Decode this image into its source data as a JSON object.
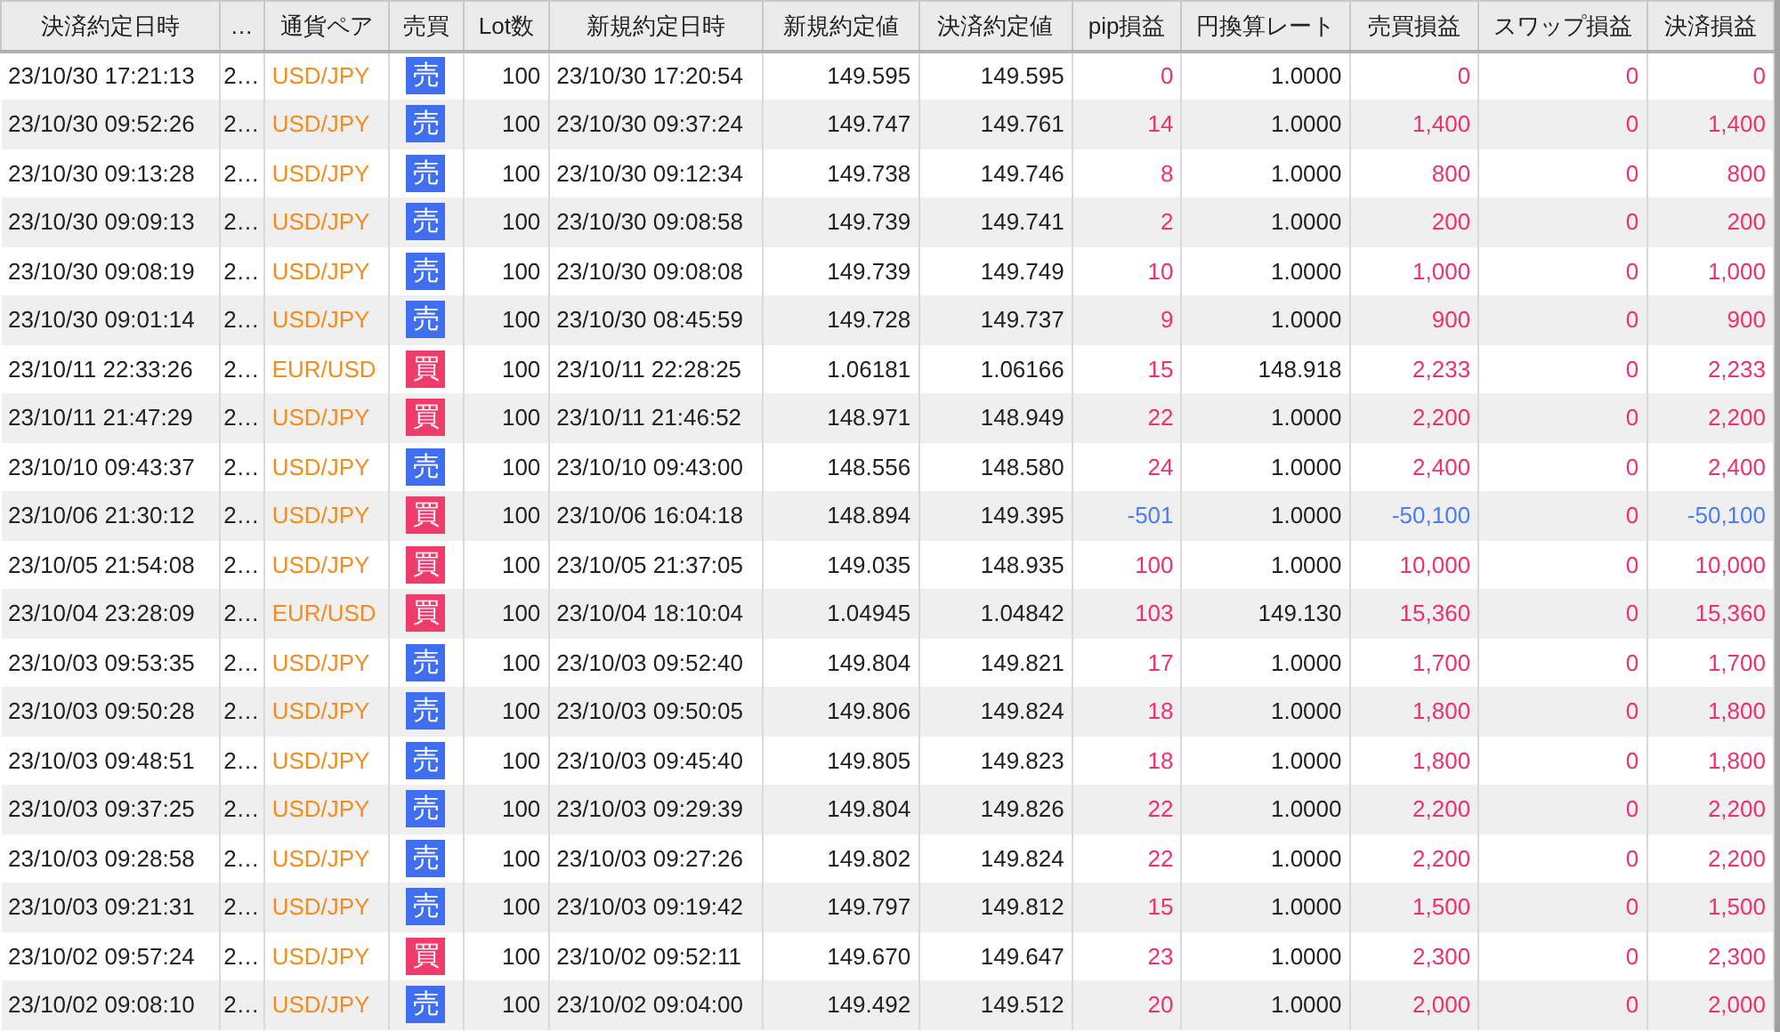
{
  "table": {
    "columns": [
      "決済約定日時",
      "…",
      "通貨ペア",
      "売買",
      "Lot数",
      "新規約定日時",
      "新規約定値",
      "決済約定値",
      "pip損益",
      "円換算レート",
      "売買損益",
      "スワップ損益",
      "決済損益"
    ],
    "rows": [
      {
        "close_time": "23/10/30 17:21:13",
        "column_2": "2…",
        "pair": "USD/JPY",
        "side": {
          "text": "売",
          "kind": "sell"
        },
        "lots": "100",
        "open_time": "23/10/30 17:20:54",
        "open_price": "149.595",
        "close_price": "149.595",
        "pips": "0",
        "rate": "1.0000",
        "trade_pl": "0",
        "swap_pl": "0",
        "settle_pl": "0",
        "loss": false
      },
      {
        "close_time": "23/10/30 09:52:26",
        "column_2": "2…",
        "pair": "USD/JPY",
        "side": {
          "text": "売",
          "kind": "sell"
        },
        "lots": "100",
        "open_time": "23/10/30 09:37:24",
        "open_price": "149.747",
        "close_price": "149.761",
        "pips": "14",
        "rate": "1.0000",
        "trade_pl": "1,400",
        "swap_pl": "0",
        "settle_pl": "1,400",
        "loss": false
      },
      {
        "close_time": "23/10/30 09:13:28",
        "column_2": "2…",
        "pair": "USD/JPY",
        "side": {
          "text": "売",
          "kind": "sell"
        },
        "lots": "100",
        "open_time": "23/10/30 09:12:34",
        "open_price": "149.738",
        "close_price": "149.746",
        "pips": "8",
        "rate": "1.0000",
        "trade_pl": "800",
        "swap_pl": "0",
        "settle_pl": "800",
        "loss": false
      },
      {
        "close_time": "23/10/30 09:09:13",
        "column_2": "2…",
        "pair": "USD/JPY",
        "side": {
          "text": "売",
          "kind": "sell"
        },
        "lots": "100",
        "open_time": "23/10/30 09:08:58",
        "open_price": "149.739",
        "close_price": "149.741",
        "pips": "2",
        "rate": "1.0000",
        "trade_pl": "200",
        "swap_pl": "0",
        "settle_pl": "200",
        "loss": false
      },
      {
        "close_time": "23/10/30 09:08:19",
        "column_2": "2…",
        "pair": "USD/JPY",
        "side": {
          "text": "売",
          "kind": "sell"
        },
        "lots": "100",
        "open_time": "23/10/30 09:08:08",
        "open_price": "149.739",
        "close_price": "149.749",
        "pips": "10",
        "rate": "1.0000",
        "trade_pl": "1,000",
        "swap_pl": "0",
        "settle_pl": "1,000",
        "loss": false
      },
      {
        "close_time": "23/10/30 09:01:14",
        "column_2": "2…",
        "pair": "USD/JPY",
        "side": {
          "text": "売",
          "kind": "sell"
        },
        "lots": "100",
        "open_time": "23/10/30 08:45:59",
        "open_price": "149.728",
        "close_price": "149.737",
        "pips": "9",
        "rate": "1.0000",
        "trade_pl": "900",
        "swap_pl": "0",
        "settle_pl": "900",
        "loss": false
      },
      {
        "close_time": "23/10/11 22:33:26",
        "column_2": "2…",
        "pair": "EUR/USD",
        "side": {
          "text": "買",
          "kind": "buy"
        },
        "lots": "100",
        "open_time": "23/10/11 22:28:25",
        "open_price": "1.06181",
        "close_price": "1.06166",
        "pips": "15",
        "rate": "148.918",
        "trade_pl": "2,233",
        "swap_pl": "0",
        "settle_pl": "2,233",
        "loss": false
      },
      {
        "close_time": "23/10/11 21:47:29",
        "column_2": "2…",
        "pair": "USD/JPY",
        "side": {
          "text": "買",
          "kind": "buy"
        },
        "lots": "100",
        "open_time": "23/10/11 21:46:52",
        "open_price": "148.971",
        "close_price": "148.949",
        "pips": "22",
        "rate": "1.0000",
        "trade_pl": "2,200",
        "swap_pl": "0",
        "settle_pl": "2,200",
        "loss": false
      },
      {
        "close_time": "23/10/10 09:43:37",
        "column_2": "2…",
        "pair": "USD/JPY",
        "side": {
          "text": "売",
          "kind": "sell"
        },
        "lots": "100",
        "open_time": "23/10/10 09:43:00",
        "open_price": "148.556",
        "close_price": "148.580",
        "pips": "24",
        "rate": "1.0000",
        "trade_pl": "2,400",
        "swap_pl": "0",
        "settle_pl": "2,400",
        "loss": false
      },
      {
        "close_time": "23/10/06 21:30:12",
        "column_2": "2…",
        "pair": "USD/JPY",
        "side": {
          "text": "買",
          "kind": "buy"
        },
        "lots": "100",
        "open_time": "23/10/06 16:04:18",
        "open_price": "148.894",
        "close_price": "149.395",
        "pips": "-501",
        "rate": "1.0000",
        "trade_pl": "-50,100",
        "swap_pl": "0",
        "settle_pl": "-50,100",
        "loss": true
      },
      {
        "close_time": "23/10/05 21:54:08",
        "column_2": "2…",
        "pair": "USD/JPY",
        "side": {
          "text": "買",
          "kind": "buy"
        },
        "lots": "100",
        "open_time": "23/10/05 21:37:05",
        "open_price": "149.035",
        "close_price": "148.935",
        "pips": "100",
        "rate": "1.0000",
        "trade_pl": "10,000",
        "swap_pl": "0",
        "settle_pl": "10,000",
        "loss": false
      },
      {
        "close_time": "23/10/04 23:28:09",
        "column_2": "2…",
        "pair": "EUR/USD",
        "side": {
          "text": "買",
          "kind": "buy"
        },
        "lots": "100",
        "open_time": "23/10/04 18:10:04",
        "open_price": "1.04945",
        "close_price": "1.04842",
        "pips": "103",
        "rate": "149.130",
        "trade_pl": "15,360",
        "swap_pl": "0",
        "settle_pl": "15,360",
        "loss": false
      },
      {
        "close_time": "23/10/03 09:53:35",
        "column_2": "2…",
        "pair": "USD/JPY",
        "side": {
          "text": "売",
          "kind": "sell"
        },
        "lots": "100",
        "open_time": "23/10/03 09:52:40",
        "open_price": "149.804",
        "close_price": "149.821",
        "pips": "17",
        "rate": "1.0000",
        "trade_pl": "1,700",
        "swap_pl": "0",
        "settle_pl": "1,700",
        "loss": false
      },
      {
        "close_time": "23/10/03 09:50:28",
        "column_2": "2…",
        "pair": "USD/JPY",
        "side": {
          "text": "売",
          "kind": "sell"
        },
        "lots": "100",
        "open_time": "23/10/03 09:50:05",
        "open_price": "149.806",
        "close_price": "149.824",
        "pips": "18",
        "rate": "1.0000",
        "trade_pl": "1,800",
        "swap_pl": "0",
        "settle_pl": "1,800",
        "loss": false
      },
      {
        "close_time": "23/10/03 09:48:51",
        "column_2": "2…",
        "pair": "USD/JPY",
        "side": {
          "text": "売",
          "kind": "sell"
        },
        "lots": "100",
        "open_time": "23/10/03 09:45:40",
        "open_price": "149.805",
        "close_price": "149.823",
        "pips": "18",
        "rate": "1.0000",
        "trade_pl": "1,800",
        "swap_pl": "0",
        "settle_pl": "1,800",
        "loss": false
      },
      {
        "close_time": "23/10/03 09:37:25",
        "column_2": "2…",
        "pair": "USD/JPY",
        "side": {
          "text": "売",
          "kind": "sell"
        },
        "lots": "100",
        "open_time": "23/10/03 09:29:39",
        "open_price": "149.804",
        "close_price": "149.826",
        "pips": "22",
        "rate": "1.0000",
        "trade_pl": "2,200",
        "swap_pl": "0",
        "settle_pl": "2,200",
        "loss": false
      },
      {
        "close_time": "23/10/03 09:28:58",
        "column_2": "2…",
        "pair": "USD/JPY",
        "side": {
          "text": "売",
          "kind": "sell"
        },
        "lots": "100",
        "open_time": "23/10/03 09:27:26",
        "open_price": "149.802",
        "close_price": "149.824",
        "pips": "22",
        "rate": "1.0000",
        "trade_pl": "2,200",
        "swap_pl": "0",
        "settle_pl": "2,200",
        "loss": false
      },
      {
        "close_time": "23/10/03 09:21:31",
        "column_2": "2…",
        "pair": "USD/JPY",
        "side": {
          "text": "売",
          "kind": "sell"
        },
        "lots": "100",
        "open_time": "23/10/03 09:19:42",
        "open_price": "149.797",
        "close_price": "149.812",
        "pips": "15",
        "rate": "1.0000",
        "trade_pl": "1,500",
        "swap_pl": "0",
        "settle_pl": "1,500",
        "loss": false
      },
      {
        "close_time": "23/10/02 09:57:24",
        "column_2": "2…",
        "pair": "USD/JPY",
        "side": {
          "text": "買",
          "kind": "buy"
        },
        "lots": "100",
        "open_time": "23/10/02 09:52:11",
        "open_price": "149.670",
        "close_price": "149.647",
        "pips": "23",
        "rate": "1.0000",
        "trade_pl": "2,300",
        "swap_pl": "0",
        "settle_pl": "2,300",
        "loss": false
      },
      {
        "close_time": "23/10/02 09:08:10",
        "column_2": "2…",
        "pair": "USD/JPY",
        "side": {
          "text": "売",
          "kind": "sell"
        },
        "lots": "100",
        "open_time": "23/10/02 09:04:00",
        "open_price": "149.492",
        "close_price": "149.512",
        "pips": "20",
        "rate": "1.0000",
        "trade_pl": "2,000",
        "swap_pl": "0",
        "settle_pl": "2,000",
        "loss": false
      }
    ]
  }
}
